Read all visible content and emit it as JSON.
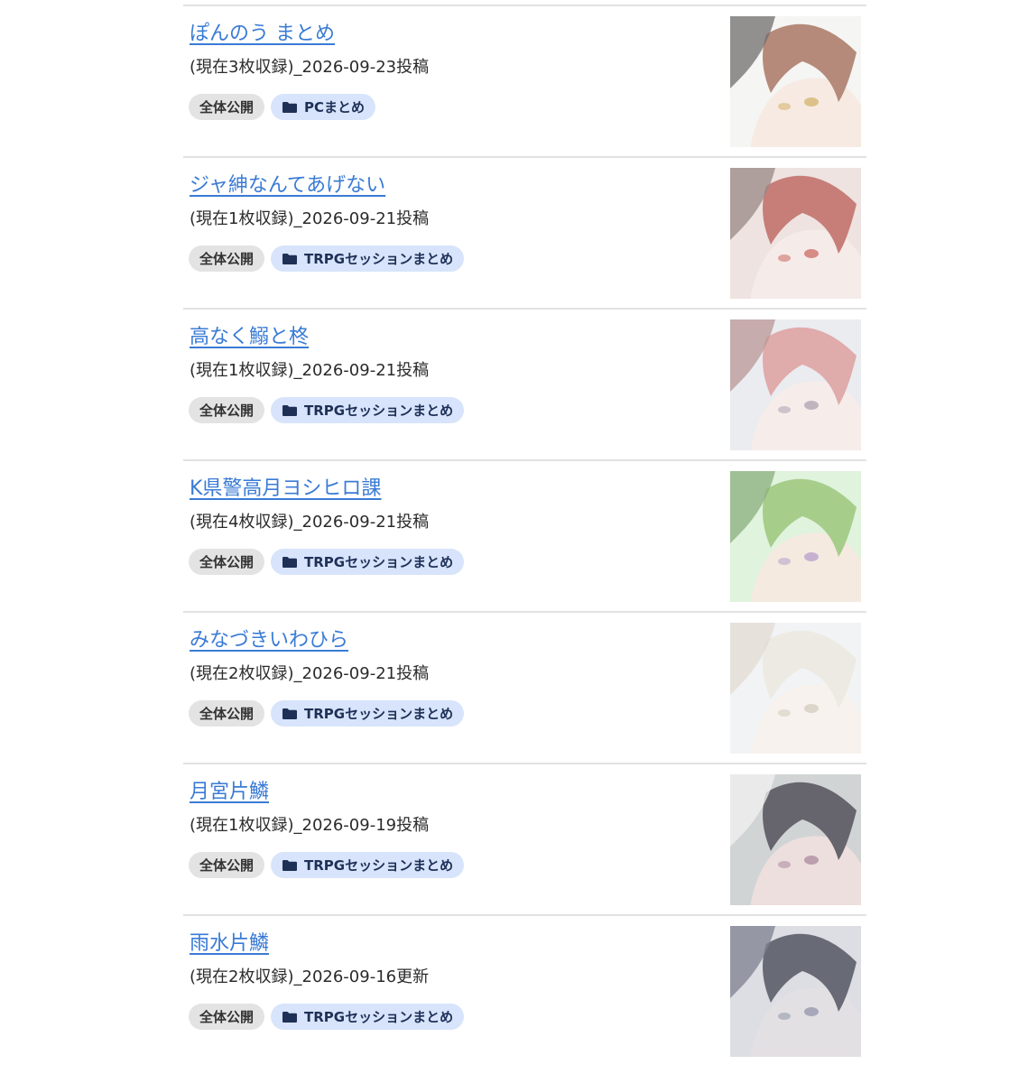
{
  "entries": [
    {
      "title": "ぽんのう まとめ",
      "meta": "(現在3枚収録)_2026-09-23投稿",
      "visibility": "全体公開",
      "folder": "PCまとめ",
      "thumb_colors": {
        "bg": "#f3f2f0",
        "a": "#a06a55",
        "b": "#4a4646",
        "skin": "#f4e4dc",
        "accent": "#c9a24a"
      }
    },
    {
      "title": "ジャ紳なんてあげない",
      "meta": "(現在1枚収録)_2026-09-21投稿",
      "visibility": "全体公開",
      "folder": "TRPGセッションまとめ",
      "thumb_colors": {
        "bg": "#e9dcd8",
        "a": "#b85a52",
        "b": "#7d6763",
        "skin": "#f3e6e2",
        "accent": "#c24c44"
      }
    },
    {
      "title": "高なく鰯と柊",
      "meta": "(現在1枚収録)_2026-09-21投稿",
      "visibility": "全体公開",
      "folder": "TRPGセッションまとめ",
      "thumb_colors": {
        "bg": "#e4e7ec",
        "a": "#d89494",
        "b": "#a87a78",
        "skin": "#f4e8e6",
        "accent": "#9b8fa0"
      }
    },
    {
      "title": "K県警高月ヨシヒロ課",
      "meta": "(現在4枚収録)_2026-09-21投稿",
      "visibility": "全体公開",
      "folder": "TRPGセッションまとめ",
      "thumb_colors": {
        "bg": "#d6f0d4",
        "a": "#8fbf6a",
        "b": "#6a9a5a",
        "skin": "#f3e5d8",
        "accent": "#a98ac0"
      }
    },
    {
      "title": "みなづきいわひら",
      "meta": "(現在2枚収録)_2026-09-21投稿",
      "visibility": "全体公開",
      "folder": "TRPGセッションまとめ",
      "thumb_colors": {
        "bg": "#eef0f2",
        "a": "#e8e4dc",
        "b": "#d9d2c4",
        "skin": "#f5efe8",
        "accent": "#c8c0b0"
      }
    },
    {
      "title": "月宮片鱗",
      "meta": "(現在1枚収録)_2026-09-19投稿",
      "visibility": "全体公開",
      "folder": "TRPGセッションまとめ",
      "thumb_colors": {
        "bg": "#c5c8ca",
        "a": "#3c3a44",
        "b": "#eeeeee",
        "skin": "#e8d6d4",
        "accent": "#9a7088"
      }
    },
    {
      "title": "雨水片鱗",
      "meta": "(現在2枚収録)_2026-09-16更新",
      "visibility": "全体公開",
      "folder": "TRPGセッションまとめ",
      "thumb_colors": {
        "bg": "#d2d5dc",
        "a": "#3e4250",
        "b": "#5a5e70",
        "skin": "#dcd8dc",
        "accent": "#7a7e98"
      }
    }
  ],
  "icons": {
    "folder": "folder-icon"
  },
  "colors": {
    "link": "#3a7bd5",
    "tag_public_bg": "#e3e3e3",
    "tag_folder_bg": "#d7e4fb",
    "divider": "#e2e2e2"
  }
}
